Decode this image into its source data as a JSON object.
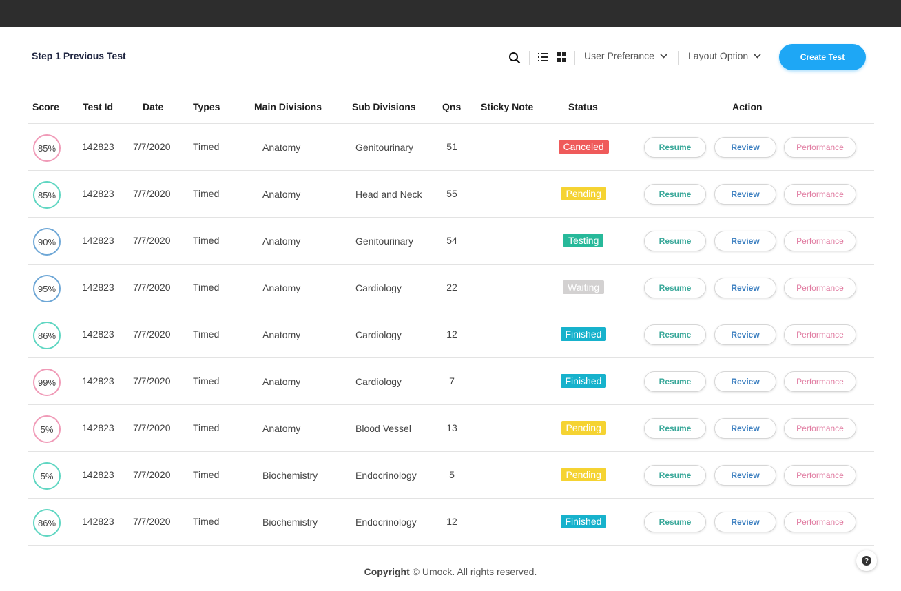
{
  "page": {
    "title": "Step 1 Previous Test"
  },
  "toolbar": {
    "search_icon": "search-icon",
    "list_view_icon": "list-view-icon",
    "grid_view_icon": "grid-view-icon",
    "user_preference_label": "User Preferance",
    "layout_option_label": "Layout Option",
    "create_test_label": "Create Test",
    "accent_color": "#1ea7f5"
  },
  "table": {
    "headers": {
      "score": "Score",
      "test_id": "Test Id",
      "date": "Date",
      "types": "Types",
      "main_divisions": "Main Divisions",
      "sub_divisions": "Sub Divisions",
      "qns": "Qns",
      "sticky_note": "Sticky Note",
      "status": "Status",
      "action": "Action"
    },
    "action_labels": {
      "resume": "Resume",
      "review": "Review",
      "performance": "Performance"
    },
    "status_colors": {
      "Canceled": "#ef5a5a",
      "Pending": "#f5d332",
      "Testing": "#27b99a",
      "Waiting": "#d3d1d1",
      "Finished": "#17b2cc"
    },
    "rows": [
      {
        "score": "85%",
        "ring_color": "#f09ab7",
        "test_id": "142823",
        "date": "7/7/2020",
        "type": "Timed",
        "main_division": "Anatomy",
        "sub_division": "Genitourinary",
        "qns": "51",
        "sticky_note": "",
        "status": "Canceled"
      },
      {
        "score": "85%",
        "ring_color": "#5fd6c2",
        "test_id": "142823",
        "date": "7/7/2020",
        "type": "Timed",
        "main_division": "Anatomy",
        "sub_division": "Head and Neck",
        "qns": "55",
        "sticky_note": "",
        "status": "Pending"
      },
      {
        "score": "90%",
        "ring_color": "#6ea7d6",
        "test_id": "142823",
        "date": "7/7/2020",
        "type": "Timed",
        "main_division": "Anatomy",
        "sub_division": "Genitourinary",
        "qns": "54",
        "sticky_note": "",
        "status": "Testing"
      },
      {
        "score": "95%",
        "ring_color": "#6ea7d6",
        "test_id": "142823",
        "date": "7/7/2020",
        "type": "Timed",
        "main_division": "Anatomy",
        "sub_division": "Cardiology",
        "qns": "22",
        "sticky_note": "",
        "status": "Waiting"
      },
      {
        "score": "86%",
        "ring_color": "#5fd6c2",
        "test_id": "142823",
        "date": "7/7/2020",
        "type": "Timed",
        "main_division": "Anatomy",
        "sub_division": "Cardiology",
        "qns": "12",
        "sticky_note": "",
        "status": "Finished"
      },
      {
        "score": "99%",
        "ring_color": "#f09ab7",
        "test_id": "142823",
        "date": "7/7/2020",
        "type": "Timed",
        "main_division": "Anatomy",
        "sub_division": "Cardiology",
        "qns": "7",
        "sticky_note": "",
        "status": "Finished"
      },
      {
        "score": "5%",
        "ring_color": "#f09ab7",
        "test_id": "142823",
        "date": "7/7/2020",
        "type": "Timed",
        "main_division": "Anatomy",
        "sub_division": "Blood Vessel",
        "qns": "13",
        "sticky_note": "",
        "status": "Pending"
      },
      {
        "score": "5%",
        "ring_color": "#5fd6c2",
        "test_id": "142823",
        "date": "7/7/2020",
        "type": "Timed",
        "main_division": "Biochemistry",
        "sub_division": "Endocrinology",
        "qns": "5",
        "sticky_note": "",
        "status": "Pending"
      },
      {
        "score": "86%",
        "ring_color": "#5fd6c2",
        "test_id": "142823",
        "date": "7/7/2020",
        "type": "Timed",
        "main_division": "Biochemistry",
        "sub_division": "Endocrinology",
        "qns": "12",
        "sticky_note": "",
        "status": "Finished"
      }
    ]
  },
  "footer": {
    "copyright_label": "Copyright",
    "copyright_text": "© Umock. All rights reserved.",
    "help_icon": "help-icon"
  }
}
